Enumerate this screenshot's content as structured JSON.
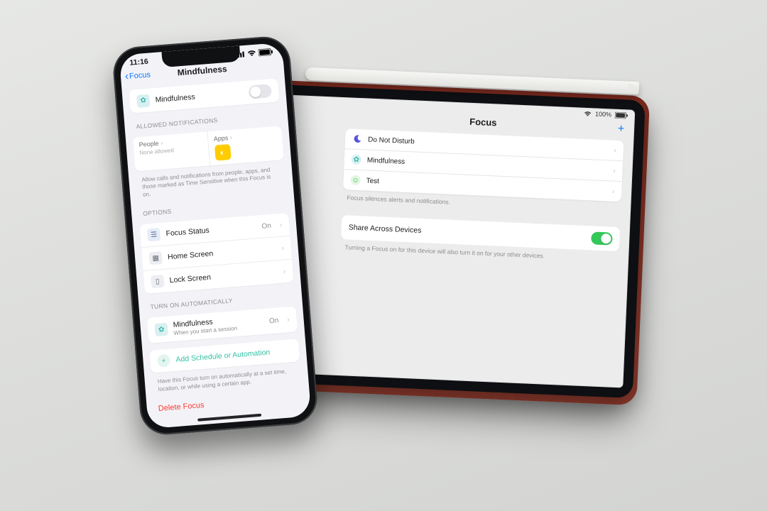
{
  "ipad": {
    "status": {
      "battery": "100%"
    },
    "title": "Focus",
    "add_glyph": "+",
    "rows": [
      {
        "label": "Do Not Disturb"
      },
      {
        "label": "Mindfulness"
      },
      {
        "label": "Test"
      }
    ],
    "list_footer": "Focus silences alerts and notifications.",
    "share": {
      "label": "Share Across Devices",
      "footer": "Turning a Focus on for this device will also turn it on for your other devices."
    }
  },
  "iphone": {
    "status": {
      "time": "11:16"
    },
    "nav": {
      "back": "Focus",
      "title": "Mindfulness"
    },
    "hero": {
      "label": "Mindfulness"
    },
    "allowed": {
      "title": "ALLOWED NOTIFICATIONS",
      "people_label": "People",
      "people_sub": "None allowed",
      "apps_label": "Apps",
      "footer": "Allow calls and notifications from people, apps, and those marked as Time Sensitive when this Focus is on."
    },
    "options": {
      "title": "OPTIONS",
      "focus_status": "Focus Status",
      "focus_status_value": "On",
      "home_screen": "Home Screen",
      "lock_screen": "Lock Screen"
    },
    "automation": {
      "title": "TURN ON AUTOMATICALLY",
      "mind_label": "Mindfulness",
      "mind_sub": "When you start a session",
      "mind_value": "On",
      "add": "Add Schedule or Automation",
      "footer": "Have this Focus turn on automatically at a set time, location, or while using a certain app."
    },
    "delete": "Delete Focus"
  }
}
